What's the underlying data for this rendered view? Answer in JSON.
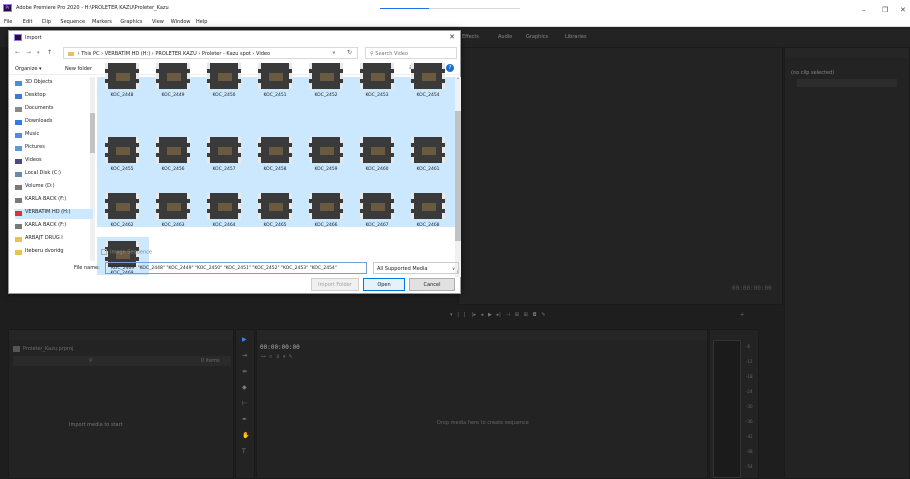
{
  "app": {
    "title": "Adobe Premiere Pro 2020 - H:\\PROLETER KAZU\\Proleter_Kazu",
    "menu": [
      "File",
      "Edit",
      "Clip",
      "Sequence",
      "Markers",
      "Graphics",
      "View",
      "Window",
      "Help"
    ],
    "import_progress": 0.35
  },
  "workspace": {
    "tabs": [
      "Effects",
      "Audio",
      "Graphics",
      "Libraries"
    ]
  },
  "source_panel": {
    "no_clip": "(no clip selected)"
  },
  "program_panel": {
    "timecode": "00:00:00:00"
  },
  "project_panel": {
    "project_name": "Proleter_Kazu.prproj",
    "items_count": "0 items",
    "empty_hint": "Import media to start"
  },
  "timeline_panel": {
    "timecode": "00:00:00:00",
    "drop_hint": "Drop media here to create sequence"
  },
  "meter_ticks": [
    "-6",
    "-12",
    "-18",
    "-24",
    "-30",
    "-36",
    "-42",
    "-48",
    "-54"
  ],
  "dialog": {
    "title": "Import",
    "breadcrumb": [
      "This PC",
      "VERBATIM HD (H:)",
      "PROLETER KAZU",
      "Proleter - Kazu spot",
      "Video"
    ],
    "search_placeholder": "Search Video",
    "organize": "Organize ▾",
    "new_folder": "New folder",
    "nav_items": [
      {
        "label": "3D Objects",
        "color": "#4a90d9"
      },
      {
        "label": "Desktop",
        "color": "#3a7bd5"
      },
      {
        "label": "Documents",
        "color": "#8a8a8a"
      },
      {
        "label": "Downloads",
        "color": "#2f7de1"
      },
      {
        "label": "Music",
        "color": "#5a8ad8"
      },
      {
        "label": "Pictures",
        "color": "#5a9ad8"
      },
      {
        "label": "Videos",
        "color": "#4a4a8a"
      },
      {
        "label": "Local Disk (C:)",
        "color": "#6a8aaa"
      },
      {
        "label": "Volume (D:)",
        "color": "#7a7a7a"
      },
      {
        "label": "KARLA BACK (F:)",
        "color": "#7a7a7a"
      },
      {
        "label": "VERBATIM HD (H:)",
        "color": "#d33",
        "selected": true
      },
      {
        "label": "KARLA BACK (F:)",
        "color": "#7a7a7a"
      },
      {
        "label": "ARBAJT DRUG I",
        "color": "#e8c15a"
      },
      {
        "label": "Iteberu dvoridg",
        "color": "#e8c15a"
      }
    ],
    "files": [
      "KOC_2448",
      "KOC_2449",
      "KOC_2450",
      "KOC_2451",
      "KOC_2452",
      "KOC_2453",
      "KOC_2454",
      "KOC_2455",
      "KOC_2456",
      "KOC_2457",
      "KOC_2458",
      "KOC_2459",
      "KOC_2460",
      "KOC_2461",
      "KOC_2462",
      "KOC_2463",
      "KOC_2464",
      "KOC_2465",
      "KOC_2466",
      "KOC_2467",
      "KOC_2468",
      "KOC_2469"
    ],
    "image_sequence": "Image Sequence",
    "file_name_label": "File name:",
    "file_name_value": "\"KOC_2469\" \"KOC_2448\" \"KOC_2449\" \"KOC_2450\" \"KOC_2451\" \"KOC_2452\" \"KOC_2453\" \"KOC_2454\"",
    "file_type": "All Supported Media",
    "import_folder": "Import Folder",
    "open": "Open",
    "cancel": "Cancel"
  }
}
